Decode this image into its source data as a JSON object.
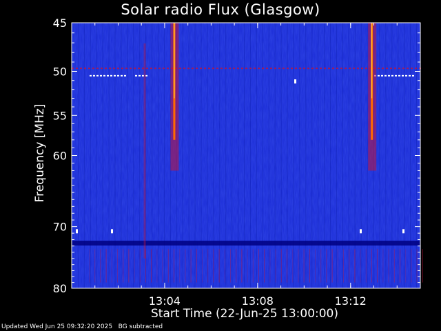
{
  "chart_data": {
    "type": "heatmap",
    "title": "Solar radio Flux (Glasgow)",
    "ylabel": "Frequency [MHz]",
    "xlabel": "Start Time (22-Jun-25 13:00:00)",
    "y_ticks": [
      45,
      50,
      55,
      60,
      70,
      80
    ],
    "x_ticks": [
      "13:04",
      "13:08",
      "13:12"
    ],
    "x_range_minutes": [
      0,
      15
    ],
    "y_range_mhz": [
      45,
      80
    ],
    "colormap": [
      "#000080",
      "#1a2bd6",
      "#c0143c",
      "#ff6a00",
      "#ffffff"
    ],
    "events": [
      {
        "time_min": 4.4,
        "label": "burst"
      },
      {
        "time_min": 12.9,
        "label": "burst"
      }
    ]
  },
  "footer": "Updated Wed Jun 25 09:32:20 2025   BG subtracted"
}
